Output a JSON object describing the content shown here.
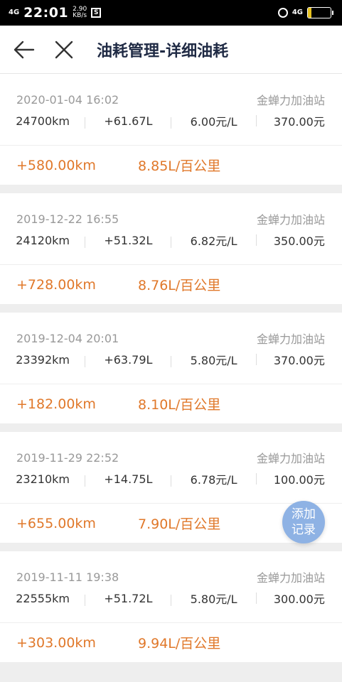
{
  "status_bar": {
    "network": "4G",
    "time": "22:01",
    "speed_value": "2.90",
    "speed_unit": "KB/s",
    "right_network": "4G",
    "battery_level": "16"
  },
  "header": {
    "title": "油耗管理-详细油耗"
  },
  "records": [
    {
      "datetime": "2020-01-04 16:02",
      "station": "金蝉力加油站",
      "odometer": "24700km",
      "fuel": "+61.67L",
      "unit_price": "6.00元/L",
      "amount": "370.00元",
      "distance": "+580.00km",
      "consumption": "8.85L/百公里"
    },
    {
      "datetime": "2019-12-22 16:55",
      "station": "金蝉力加油站",
      "odometer": "24120km",
      "fuel": "+51.32L",
      "unit_price": "6.82元/L",
      "amount": "350.00元",
      "distance": "+728.00km",
      "consumption": "8.76L/百公里"
    },
    {
      "datetime": "2019-12-04 20:01",
      "station": "金蝉力加油站",
      "odometer": "23392km",
      "fuel": "+63.79L",
      "unit_price": "5.80元/L",
      "amount": "370.00元",
      "distance": "+182.00km",
      "consumption": "8.10L/百公里"
    },
    {
      "datetime": "2019-11-29 22:52",
      "station": "金蝉力加油站",
      "odometer": "23210km",
      "fuel": "+14.75L",
      "unit_price": "6.78元/L",
      "amount": "100.00元",
      "distance": "+655.00km",
      "consumption": "7.90L/百公里"
    },
    {
      "datetime": "2019-11-11 19:38",
      "station": "金蝉力加油站",
      "odometer": "22555km",
      "fuel": "+51.72L",
      "unit_price": "5.80元/L",
      "amount": "300.00元",
      "distance": "+303.00km",
      "consumption": "9.94L/百公里"
    }
  ],
  "fab": {
    "line1": "添加",
    "line2": "记录"
  },
  "colors": {
    "accent_orange": "#e0782a",
    "fab_blue": "#8eb2e4",
    "title_navy": "#1f2a44"
  }
}
